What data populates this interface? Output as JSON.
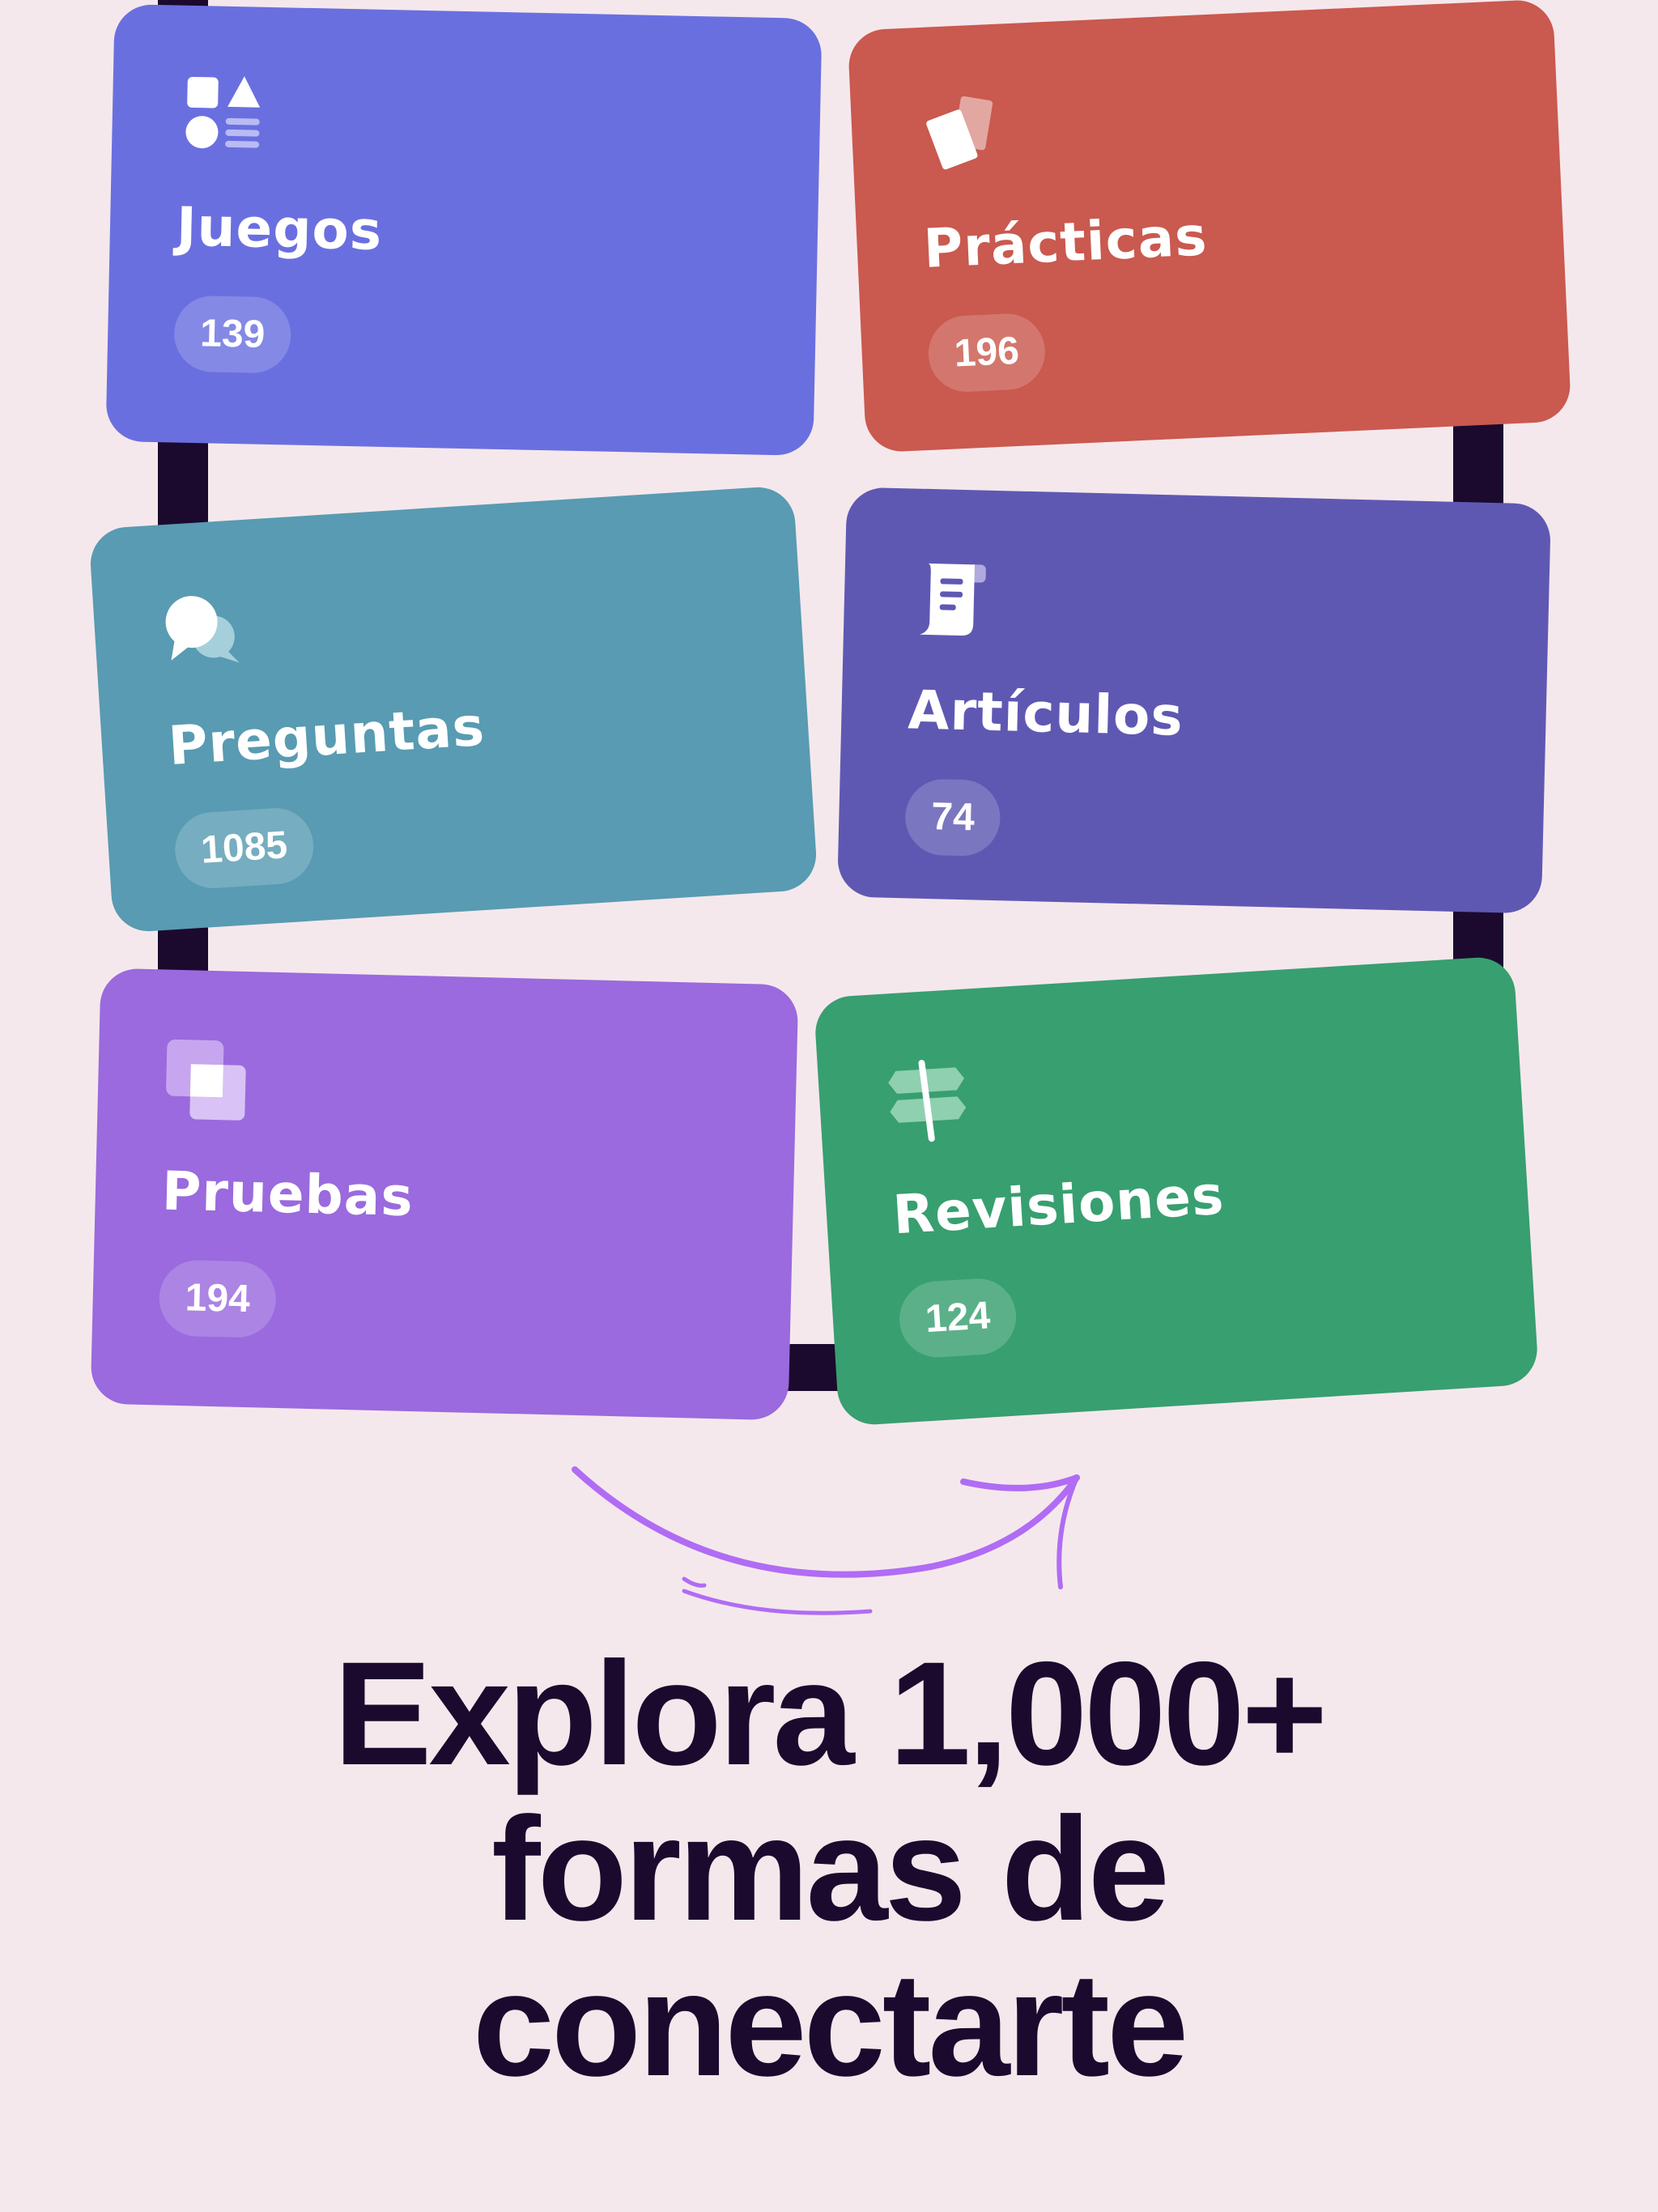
{
  "cards": [
    {
      "label": "Juegos",
      "count": "139",
      "color": "#6a6fe0",
      "icon": "shapes-icon"
    },
    {
      "label": "Prácticas",
      "count": "196",
      "color": "#ca594f",
      "icon": "cards-icon"
    },
    {
      "label": "Preguntas",
      "count": "1085",
      "color": "#589bb2",
      "icon": "chat-bubbles-icon"
    },
    {
      "label": "Artículos",
      "count": "74",
      "color": "#5f58b3",
      "icon": "scroll-document-icon"
    },
    {
      "label": "Pruebas",
      "count": "194",
      "color": "#9a6ade",
      "icon": "layered-squares-icon"
    },
    {
      "label": "Revisiones",
      "count": "124",
      "color": "#389f70",
      "icon": "signpost-icon"
    }
  ],
  "headline": {
    "line1": "Explora 1,000+",
    "line2": "formas de",
    "line3": "conectarte"
  },
  "colors": {
    "background": "#f5e8ec",
    "text": "#1b0a2e",
    "arrow": "#b06cf4"
  }
}
